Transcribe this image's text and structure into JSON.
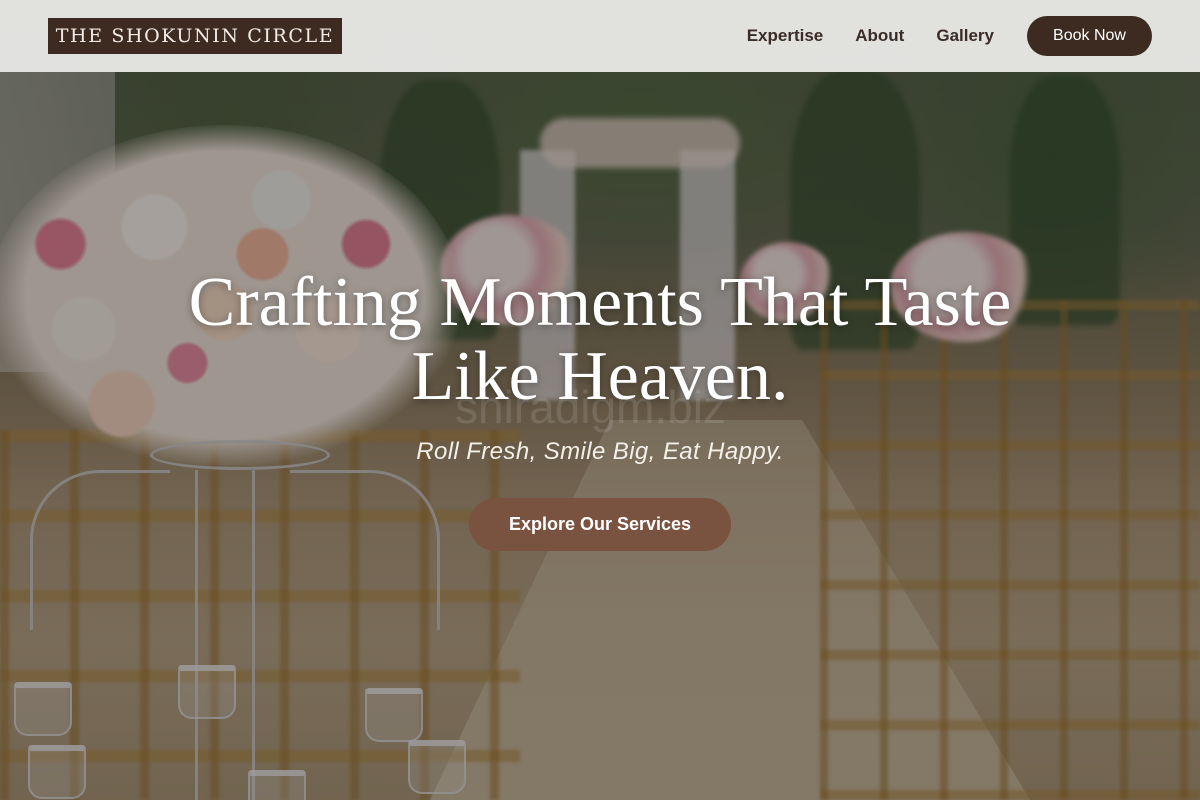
{
  "header": {
    "logo_text": "THE SHOKUNIN CIRCLE",
    "nav": [
      {
        "label": "Expertise"
      },
      {
        "label": "About"
      },
      {
        "label": "Gallery"
      }
    ],
    "cta_label": "Book Now"
  },
  "hero": {
    "headline_line1": "Crafting Moments That Taste",
    "headline_line2": "Like Heaven.",
    "tagline": "Roll Fresh, Smile Big, Eat Happy.",
    "cta_label": "Explore Our Services",
    "watermark": "shiradigm.biz"
  },
  "colors": {
    "brand_dark": "#3d2b22",
    "cta_brown": "#7a5340",
    "header_bg": "#f0f0ee"
  }
}
